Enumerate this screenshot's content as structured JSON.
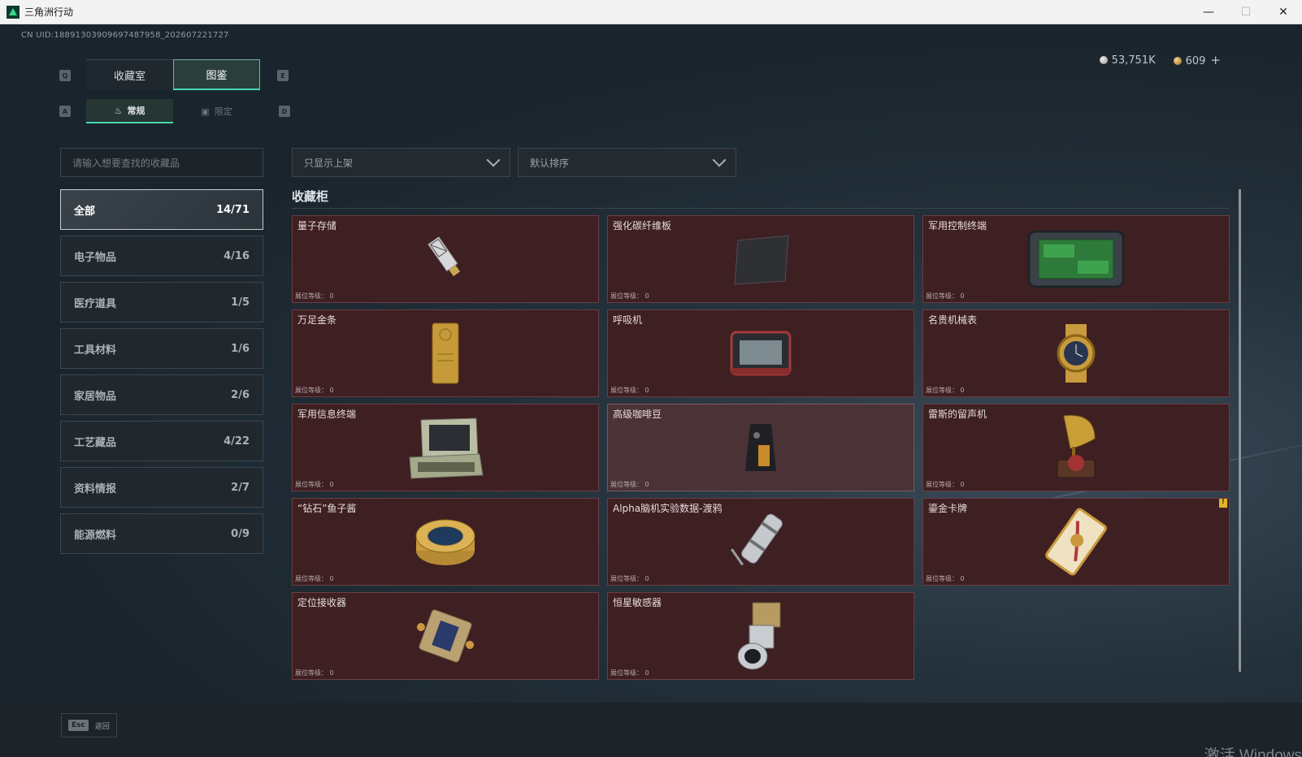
{
  "window": {
    "title": "三角洲行动",
    "controls": [
      "minimize",
      "maximize",
      "close"
    ]
  },
  "uid": "CN UID:1889130390969748795​8_2026​07221727",
  "currency": {
    "silver": "53,751K",
    "gold": "609",
    "plus": "+"
  },
  "keys": {
    "q": "Q",
    "e": "E",
    "a": "A",
    "d": "D"
  },
  "main_tabs": [
    {
      "label": "收藏室",
      "active": false
    },
    {
      "label": "图鉴",
      "active": true
    }
  ],
  "sub_tabs": [
    {
      "label": "常规",
      "active": true
    },
    {
      "label": "限定",
      "active": false
    }
  ],
  "search": {
    "placeholder": "请输入想要查找的收藏品"
  },
  "filters": {
    "shelf": "只显示上架",
    "sort": "默认排序"
  },
  "categories": [
    {
      "label": "全部",
      "count": "14/71",
      "active": true
    },
    {
      "label": "电子物品",
      "count": "4/16"
    },
    {
      "label": "医疗道具",
      "count": "1/5"
    },
    {
      "label": "工具材料",
      "count": "1/6"
    },
    {
      "label": "家居物品",
      "count": "2/6"
    },
    {
      "label": "工艺藏品",
      "count": "4/22"
    },
    {
      "label": "资料情报",
      "count": "2/7"
    },
    {
      "label": "能源燃料",
      "count": "0/9"
    }
  ],
  "section_title": "收藏柜",
  "level_label": "展位等级：",
  "items": [
    {
      "name": "量子存储",
      "level": "0",
      "icon": "usb-drive-icon"
    },
    {
      "name": "强化碳纤维板",
      "level": "0",
      "icon": "carbon-plate-icon"
    },
    {
      "name": "军用控制终端",
      "level": "0",
      "icon": "control-terminal-icon"
    },
    {
      "name": "万足金条",
      "level": "0",
      "icon": "gold-bar-icon"
    },
    {
      "name": "呼吸机",
      "level": "0",
      "icon": "ventilator-icon"
    },
    {
      "name": "名贵机械表",
      "level": "0",
      "icon": "watch-icon"
    },
    {
      "name": "军用信息终端",
      "level": "0",
      "icon": "info-terminal-icon"
    },
    {
      "name": "高级咖啡豆",
      "level": "0",
      "icon": "coffee-bag-icon",
      "highlight": true
    },
    {
      "name": "雷斯的留声机",
      "level": "0",
      "icon": "gramophone-icon"
    },
    {
      "name": "“钻石”鱼子酱",
      "level": "0",
      "icon": "caviar-tin-icon"
    },
    {
      "name": "Alpha脑机实验数据-渡鸦",
      "level": "0",
      "icon": "data-cylinder-icon"
    },
    {
      "name": "鎏金卡牌",
      "level": "0",
      "icon": "gold-card-icon",
      "badge": "!"
    },
    {
      "name": "定位接收器",
      "level": "0",
      "icon": "receiver-icon"
    },
    {
      "name": "恒星敏感器",
      "level": "0",
      "icon": "star-sensor-icon"
    }
  ],
  "bottom": {
    "esc_key": "Esc",
    "back_label": "返回"
  },
  "watermark": "激活 Windows",
  "colors": {
    "accent": "#49d6b0",
    "card_bg": "#3e1f22",
    "card_border": "#6a3f43"
  }
}
